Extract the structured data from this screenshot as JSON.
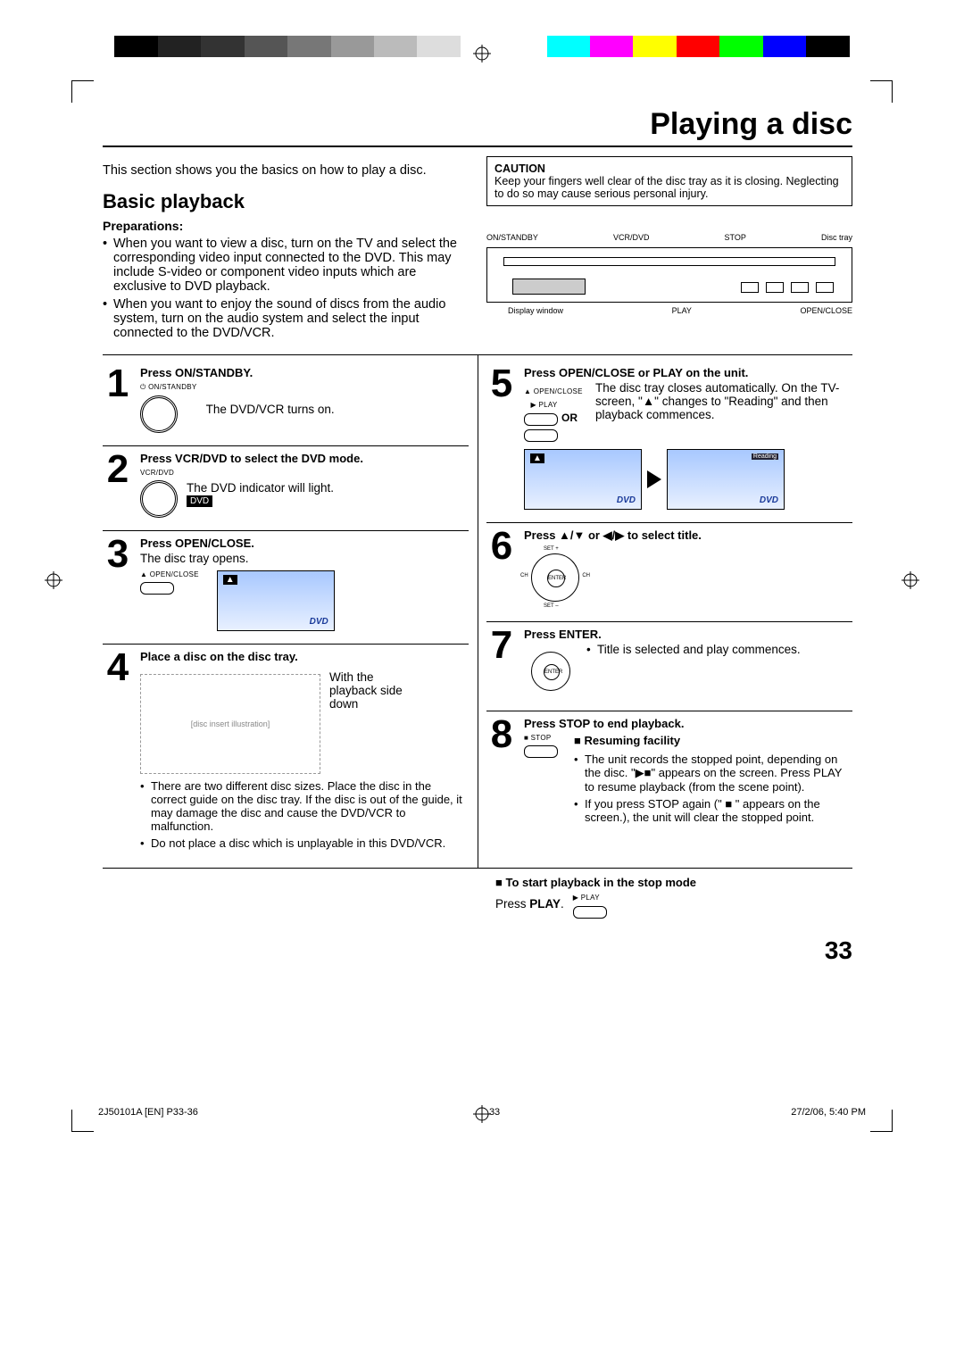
{
  "title": "Playing a disc",
  "intro": "This section shows you the basics on how to play a disc.",
  "section": "Basic playback",
  "prep_head": "Preparations:",
  "prep": [
    "When you want to view a disc, turn on the TV and select the corresponding video input connected to the DVD. This may include S-video or component video inputs which are exclusive to DVD playback.",
    "When you want to enjoy the sound of discs from the audio system, turn on the audio system and select the input connected to the DVD/VCR."
  ],
  "caution_head": "CAUTION",
  "caution_body": "Keep your fingers well clear of the disc tray as it is closing. Neglecting to do so may cause serious personal injury.",
  "device_labels_top": [
    "ON/STANDBY",
    "VCR/DVD",
    "STOP",
    "Disc tray"
  ],
  "device_labels_bottom": [
    "Display window",
    "PLAY",
    "OPEN/CLOSE"
  ],
  "steps": {
    "s1": {
      "num": "1",
      "title": "Press ON/STANDBY.",
      "desc": "The DVD/VCR turns on.",
      "icon": "ON/STANDBY"
    },
    "s2": {
      "num": "2",
      "title": "Press VCR/DVD to select the DVD mode.",
      "desc": "The DVD indicator will light.",
      "icon": "VCR/DVD",
      "badge": "DVD"
    },
    "s3": {
      "num": "3",
      "title": "Press OPEN/CLOSE.",
      "desc": "The disc tray opens.",
      "icon": "▲ OPEN/CLOSE"
    },
    "s4": {
      "num": "4",
      "title": "Place a disc on the disc tray.",
      "desc": "With the playback side down"
    },
    "s4_notes": [
      "There are two different disc sizes. Place the disc in the correct guide on the disc tray. If the disc is out of the guide, it may damage the disc and cause the DVD/VCR to malfunction.",
      "Do not place a disc which is unplayable in this DVD/VCR."
    ],
    "s5": {
      "num": "5",
      "title": "Press OPEN/CLOSE or PLAY on the unit.",
      "desc": "The disc tray closes automatically. On the TV-screen, \"▲\" changes to \"Reading\" and then playback commences.",
      "icon_a": "▲ OPEN/CLOSE",
      "icon_b": "▶ PLAY",
      "or": "OR",
      "reading": "Reading"
    },
    "s6": {
      "num": "6",
      "title": "Press ▲/▼ or ◀/▶ to select title.",
      "set_plus": "SET +",
      "set_minus": "SET –",
      "ch": "CH",
      "enter": "ENTER"
    },
    "s7": {
      "num": "7",
      "title": "Press ENTER.",
      "desc": "Title is selected and play commences."
    },
    "s8": {
      "num": "8",
      "title": "Press STOP to end playback.",
      "resume_head": "Resuming facility",
      "icon": "■ STOP",
      "bullets": [
        "The unit records the stopped point, depending on the disc. \"▶■\" appears on the screen. Press PLAY to resume playback (from the scene point).",
        "If you press STOP again (\" ■ \" appears on the screen.), the unit will clear the stopped point."
      ]
    }
  },
  "start_stop_head": "To start playback in the stop mode",
  "start_stop_body": "Press PLAY.",
  "play_icon": "▶ PLAY",
  "page_num": "33",
  "footer_left": "2J50101A [EN] P33-36",
  "footer_mid": "33",
  "footer_right": "27/2/06, 5:40 PM",
  "dvd_logo": "DVD"
}
